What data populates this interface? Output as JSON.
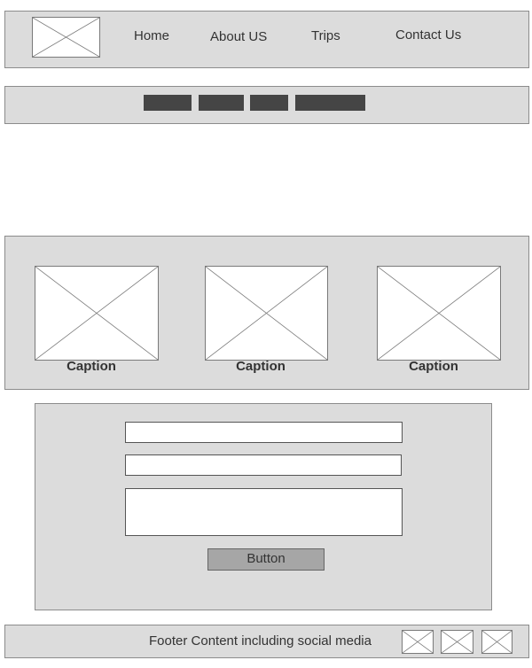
{
  "nav": {
    "links": [
      "Home",
      "About US",
      "Trips",
      "Contact Us"
    ]
  },
  "gallery": {
    "captions": [
      "Caption",
      "Caption",
      "Caption"
    ]
  },
  "form": {
    "button_label": "Button"
  },
  "footer": {
    "text": "Footer Content including social media"
  },
  "colors": {
    "panel_bg": "#dcdcdc",
    "tab_block": "#454545",
    "button_bg": "#a6a6a6"
  }
}
